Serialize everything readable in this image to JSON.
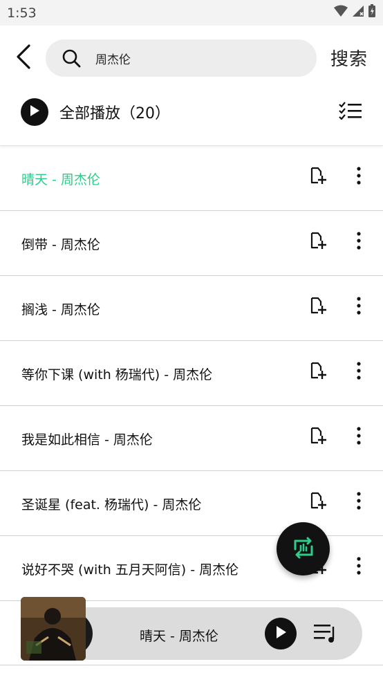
{
  "status_bar": {
    "time": "1:53",
    "icons": [
      "wifi-icon",
      "signal-icon",
      "battery-icon"
    ]
  },
  "header": {
    "back_icon": "back-arrow-icon",
    "search": {
      "value": "周杰伦",
      "placeholder": "",
      "icon": "search-icon"
    },
    "search_button_label": "搜索"
  },
  "play_all": {
    "label": "全部播放（20）",
    "play_icon": "play-icon",
    "multi_select_icon": "checklist-icon"
  },
  "songs": [
    {
      "title": "晴天 - 周杰伦",
      "active": true
    },
    {
      "title": "倒带 - 周杰伦",
      "active": false
    },
    {
      "title": "搁浅 - 周杰伦",
      "active": false
    },
    {
      "title": "等你下课 (with 杨瑞代) - 周杰伦",
      "active": false
    },
    {
      "title": "我是如此相信 - 周杰伦",
      "active": false
    },
    {
      "title": "圣诞星 (feat. 杨瑞代) - 周杰伦",
      "active": false
    },
    {
      "title": "说好不哭 (with 五月天阿信) - 周杰伦",
      "active": false
    }
  ],
  "row_icons": {
    "add": "add-to-playlist-icon",
    "more": "more-vertical-icon"
  },
  "fab": {
    "icon": "repeat-icon"
  },
  "mini_player": {
    "title": "晴天 - 周杰伦",
    "play_icon": "play-icon",
    "queue_icon": "playlist-queue-icon"
  },
  "colors": {
    "accent": "#2ecc8a",
    "dark": "#111111",
    "search_bg": "#ededed",
    "player_bg": "#dcdcdc"
  }
}
